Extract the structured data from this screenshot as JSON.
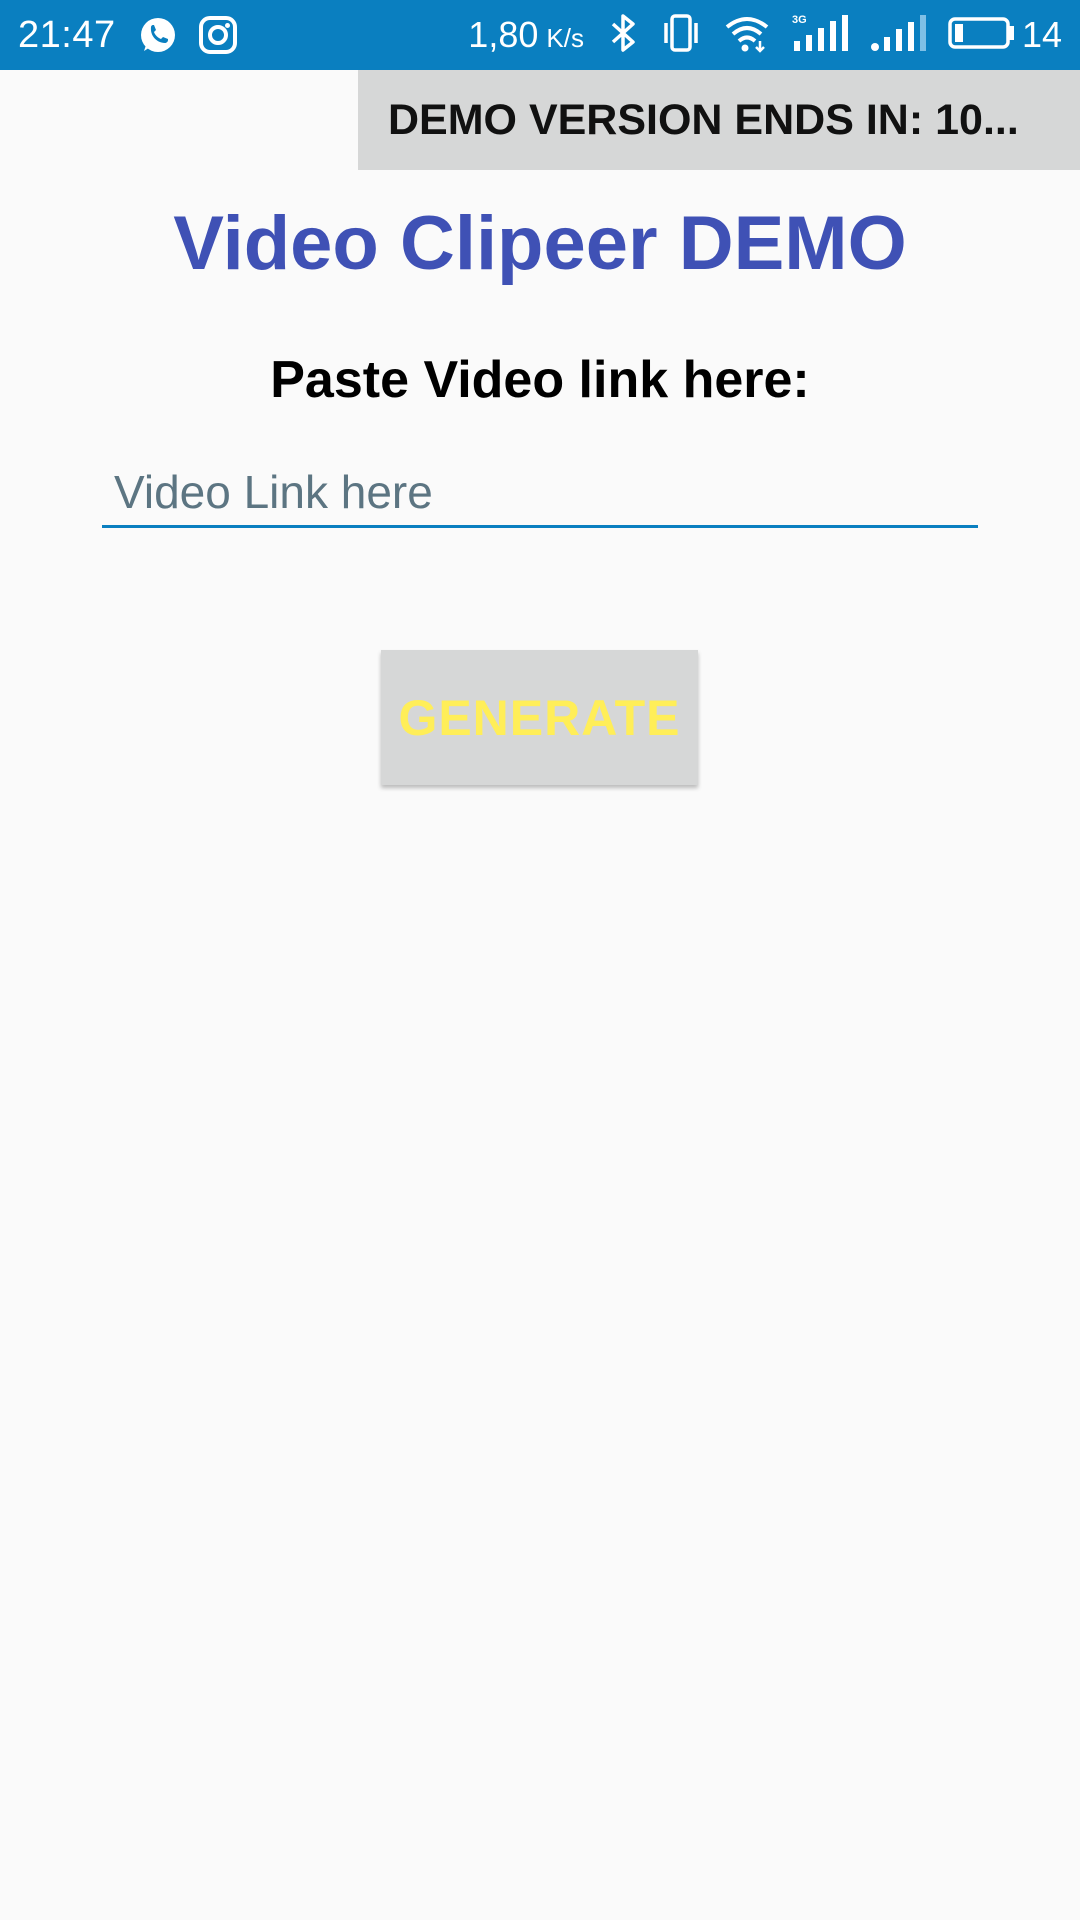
{
  "status_bar": {
    "time": "21:47",
    "left_icons": [
      "whatsapp-icon",
      "instagram-icon"
    ],
    "network_speed": "1,80",
    "network_speed_unit": "K/s",
    "right_icons": [
      "bluetooth-icon",
      "vibrate-icon",
      "wifi-icon",
      "signal-3g-icon",
      "signal-icon",
      "battery-icon"
    ],
    "battery_level": "14",
    "background_color": "#0a7fc0"
  },
  "demo_banner": {
    "text": "DEMO VERSION ENDS IN: 10..."
  },
  "main": {
    "title": "Video Clipeer DEMO",
    "title_color": "#3f51b5",
    "paste_label": "Paste Video link here:",
    "link_input": {
      "value": "",
      "placeholder": "Video Link here"
    },
    "generate_button": {
      "label": "GENERATE",
      "label_color": "#ffee58",
      "background_color": "#d6d7d7"
    }
  }
}
